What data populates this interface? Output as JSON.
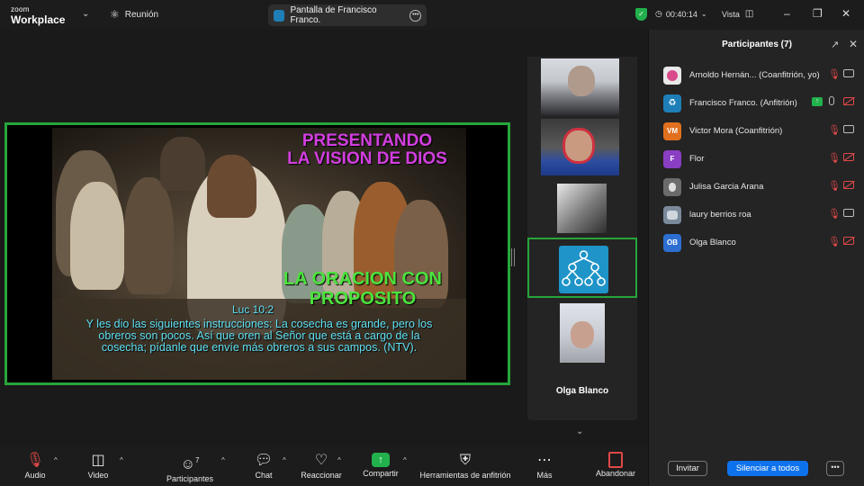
{
  "app": {
    "logo_line1": "zoom",
    "logo_line2": "Workplace",
    "meeting_label": "Reunión",
    "share_title": "Pantalla de Francisco Franco.",
    "timer": "00:40:14",
    "view_label": "Vista",
    "accent": "#0e72ed",
    "share_border": "#27a53b"
  },
  "slide": {
    "title_line1": "PRESENTANDO",
    "title_line2": "LA VISION DE DIOS",
    "subtitle_line1": "LA ORACION CON",
    "subtitle_line2": "PROPOSITO",
    "reference": "Luc 10:2",
    "verse_line1": "Y les dio las siguientes instrucciones: La cosecha es grande, pero los",
    "verse_line2": "obreros son pocos. Así que oren al Señor que está a cargo de la",
    "verse_line3": "cosecha; pídanle que envíe más obreros a sus campos. (NTV)."
  },
  "filmstrip": {
    "active_name": "Olga Blanco"
  },
  "participants_panel": {
    "title": "Participantes (7)",
    "invite_label": "Invitar",
    "mute_all_label": "Silenciar a todos",
    "items": [
      {
        "initials": "",
        "name": "Arnoldo Hernán... (Coanfitrión, yo)",
        "avatar_color": "#e8e8e8"
      },
      {
        "initials": "",
        "name": "Francisco Franco. (Anfitrión)",
        "avatar_color": "#1e7fb8"
      },
      {
        "initials": "VM",
        "name": "Victor Mora (Coanfitrión)",
        "avatar_color": "#e0701e"
      },
      {
        "initials": "F",
        "name": "Flor",
        "avatar_color": "#8a3ec4"
      },
      {
        "initials": "",
        "name": "Julisa Garcia Arana",
        "avatar_color": "#6b6b6b"
      },
      {
        "initials": "",
        "name": "laury berrios roa",
        "avatar_color": "#7a8a9a"
      },
      {
        "initials": "OB",
        "name": "Olga Blanco",
        "avatar_color": "#2d6fd0"
      }
    ]
  },
  "toolbar": {
    "audio": "Audio",
    "video": "Video",
    "participants": "Participantes",
    "participants_count": "7",
    "chat": "Chat",
    "react": "Reaccionar",
    "share": "Compartir",
    "host_tools": "Herramientas de anfitrión",
    "more": "Más",
    "leave": "Abandonar"
  }
}
